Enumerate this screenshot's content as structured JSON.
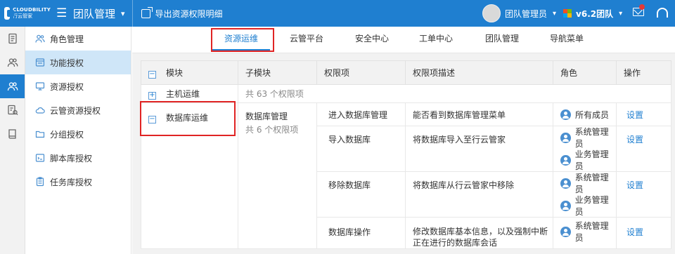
{
  "header": {
    "logo_en": "CLOUDBILITY",
    "logo_cn": "行云管家",
    "team_title": "团队管理",
    "export_label": "导出资源权限明细",
    "user_name": "团队管理员",
    "version": "v6.2团队",
    "icons": [
      "menu-icon",
      "chevron-down-icon",
      "export-icon",
      "windows-icon",
      "mail-icon",
      "headset-icon"
    ]
  },
  "rail": {
    "items": [
      {
        "name": "document-icon"
      },
      {
        "name": "users-icon"
      },
      {
        "name": "team-icon",
        "active": true
      },
      {
        "name": "audit-icon"
      },
      {
        "name": "book-icon"
      }
    ]
  },
  "subnav": {
    "items": [
      {
        "label": "角色管理",
        "icon": "role-icon"
      },
      {
        "label": "功能授权",
        "icon": "function-icon",
        "active": true
      },
      {
        "label": "资源授权",
        "icon": "monitor-icon"
      },
      {
        "label": "云管资源授权",
        "icon": "cloud-icon"
      },
      {
        "label": "分组授权",
        "icon": "folder-icon"
      },
      {
        "label": "脚本库授权",
        "icon": "script-icon"
      },
      {
        "label": "任务库授权",
        "icon": "task-icon"
      }
    ]
  },
  "tabs": [
    {
      "label": "资源运维",
      "active": true
    },
    {
      "label": "云管平台"
    },
    {
      "label": "安全中心"
    },
    {
      "label": "工单中心"
    },
    {
      "label": "团队管理"
    },
    {
      "label": "导航菜单"
    }
  ],
  "table": {
    "headers": {
      "module": "模块",
      "submodule": "子模块",
      "permission": "权限项",
      "description": "权限项描述",
      "role": "角色",
      "action": "操作"
    },
    "host_module": {
      "name": "主机运维",
      "summary": "共 63 个权限项"
    },
    "db_module": {
      "name": "数据库运维",
      "submodule": "数据库管理",
      "submodule_count": "共 6 个权限项",
      "rows": [
        {
          "permission": "进入数据库管理",
          "description": "能否看到数据库管理菜单",
          "roles": [
            "所有成员"
          ],
          "action": "设置"
        },
        {
          "permission": "导入数据库",
          "description": "将数据库导入至行云管家",
          "roles": [
            "系统管理员",
            "业务管理员"
          ],
          "action": "设置"
        },
        {
          "permission": "移除数据库",
          "description": "将数据库从行云管家中移除",
          "roles": [
            "系统管理员",
            "业务管理员"
          ],
          "action": "设置"
        },
        {
          "permission": "数据库操作",
          "description": "修改数据库基本信息，以及强制中断正在进行的数据库会话",
          "roles": [
            "系统管理员"
          ],
          "action": "设置"
        }
      ]
    }
  }
}
